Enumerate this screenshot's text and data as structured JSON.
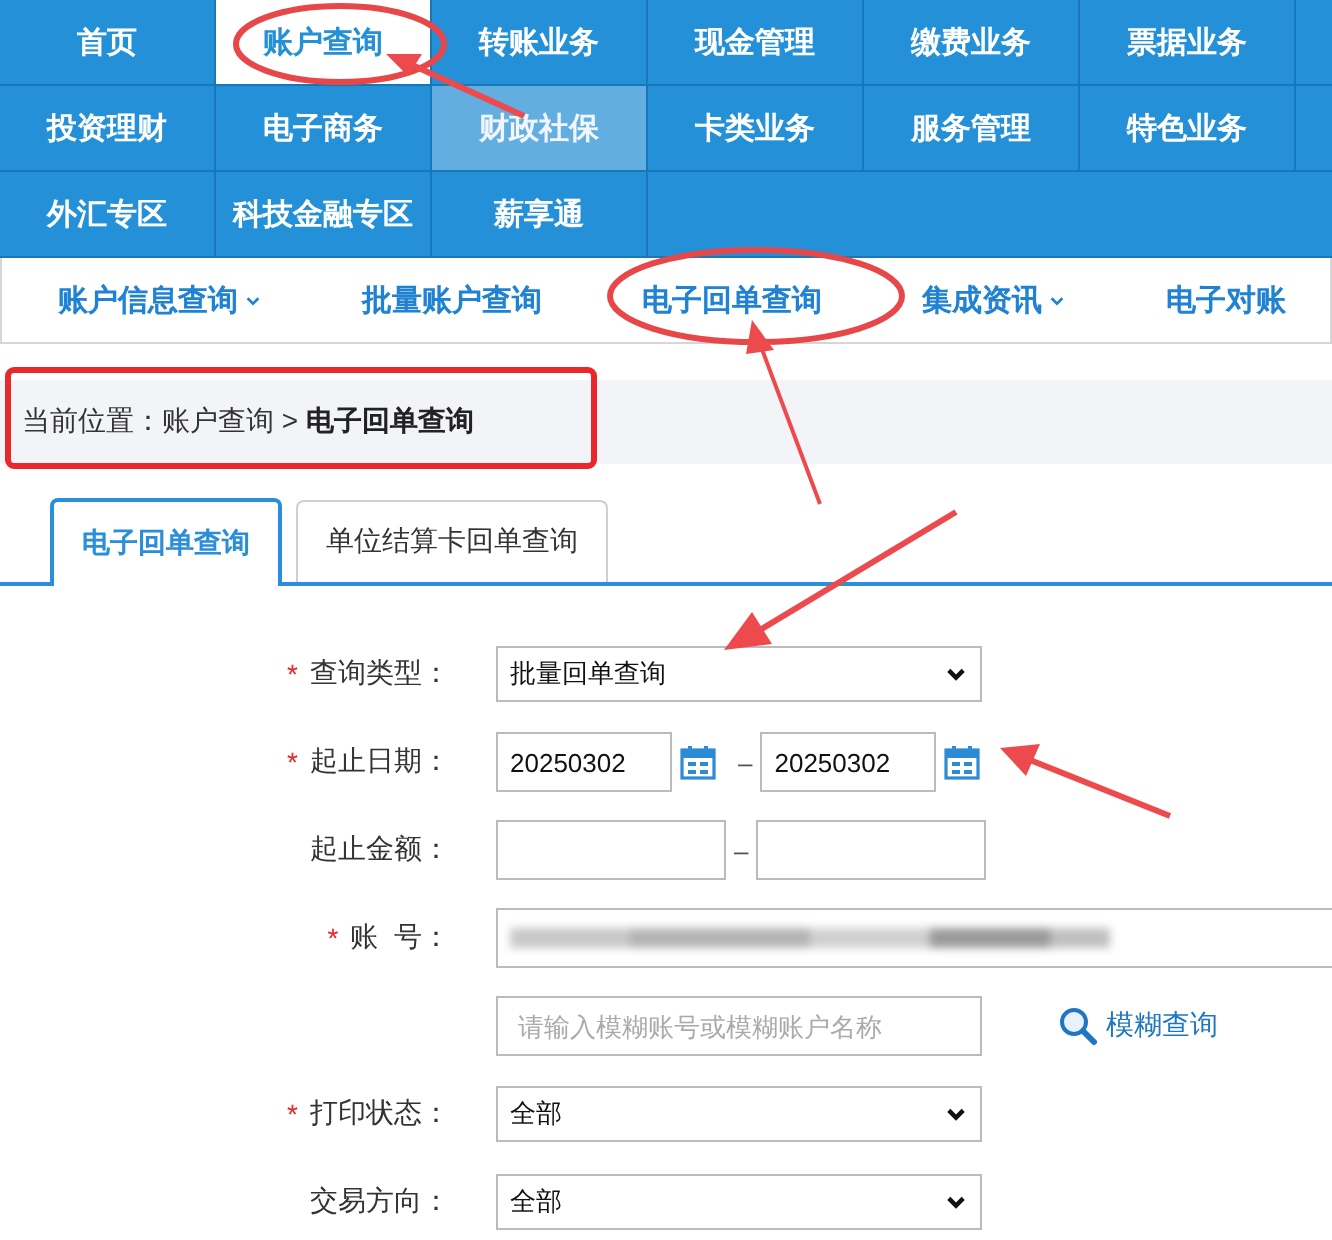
{
  "top_nav": {
    "rows": [
      {
        "items": [
          {
            "label": "首页",
            "selected": false,
            "hovered": false
          },
          {
            "label": "账户查询",
            "selected": true,
            "hovered": false
          },
          {
            "label": "转账业务",
            "selected": false,
            "hovered": false
          },
          {
            "label": "现金管理",
            "selected": false,
            "hovered": false
          },
          {
            "label": "缴费业务",
            "selected": false,
            "hovered": false
          },
          {
            "label": "票据业务",
            "selected": false,
            "hovered": false
          }
        ]
      },
      {
        "items": [
          {
            "label": "投资理财",
            "selected": false,
            "hovered": false
          },
          {
            "label": "电子商务",
            "selected": false,
            "hovered": false
          },
          {
            "label": "财政社保",
            "selected": false,
            "hovered": true
          },
          {
            "label": "卡类业务",
            "selected": false,
            "hovered": false
          },
          {
            "label": "服务管理",
            "selected": false,
            "hovered": false
          },
          {
            "label": "特色业务",
            "selected": false,
            "hovered": false
          }
        ]
      },
      {
        "items": [
          {
            "label": "外汇专区",
            "selected": false,
            "hovered": false
          },
          {
            "label": "科技金融专区",
            "selected": false,
            "hovered": false
          },
          {
            "label": "薪享通",
            "selected": false,
            "hovered": false
          }
        ]
      }
    ]
  },
  "sub_nav": [
    {
      "label": "账户信息查询",
      "dropdown": true
    },
    {
      "label": "批量账户查询",
      "dropdown": false
    },
    {
      "label": "电子回单查询",
      "dropdown": false
    },
    {
      "label": "集成资讯",
      "dropdown": true
    },
    {
      "label": "电子对账",
      "dropdown": false
    }
  ],
  "breadcrumb": "当前位置：账户查询 > **电子回单查询**",
  "tabs": [
    {
      "label": "电子回单查询",
      "selected": true
    },
    {
      "label": "单位结算卡回单查询",
      "selected": false
    }
  ],
  "form": {
    "rows": [
      {
        "kind": "select",
        "label": "查询类型：",
        "required_mark": "*",
        "value": "批量回单查询"
      },
      {
        "kind": "date_range",
        "label": "起止日期：",
        "required_mark": "*",
        "from": "20250302",
        "separator": "–",
        "to": "20250302"
      },
      {
        "kind": "range",
        "label": "起止金额：",
        "separator": "–"
      },
      {
        "kind": "masked",
        "label": "账  号：",
        "required_mark": "*"
      },
      {
        "kind": "search",
        "placeholder": "请输入模糊账号或模糊账户名称",
        "link": "模糊查询"
      },
      {
        "kind": "select",
        "label": "打印状态：",
        "required_mark": "*",
        "value": "全部"
      },
      {
        "kind": "select",
        "label": "交易方向：",
        "value": "全部"
      }
    ]
  }
}
